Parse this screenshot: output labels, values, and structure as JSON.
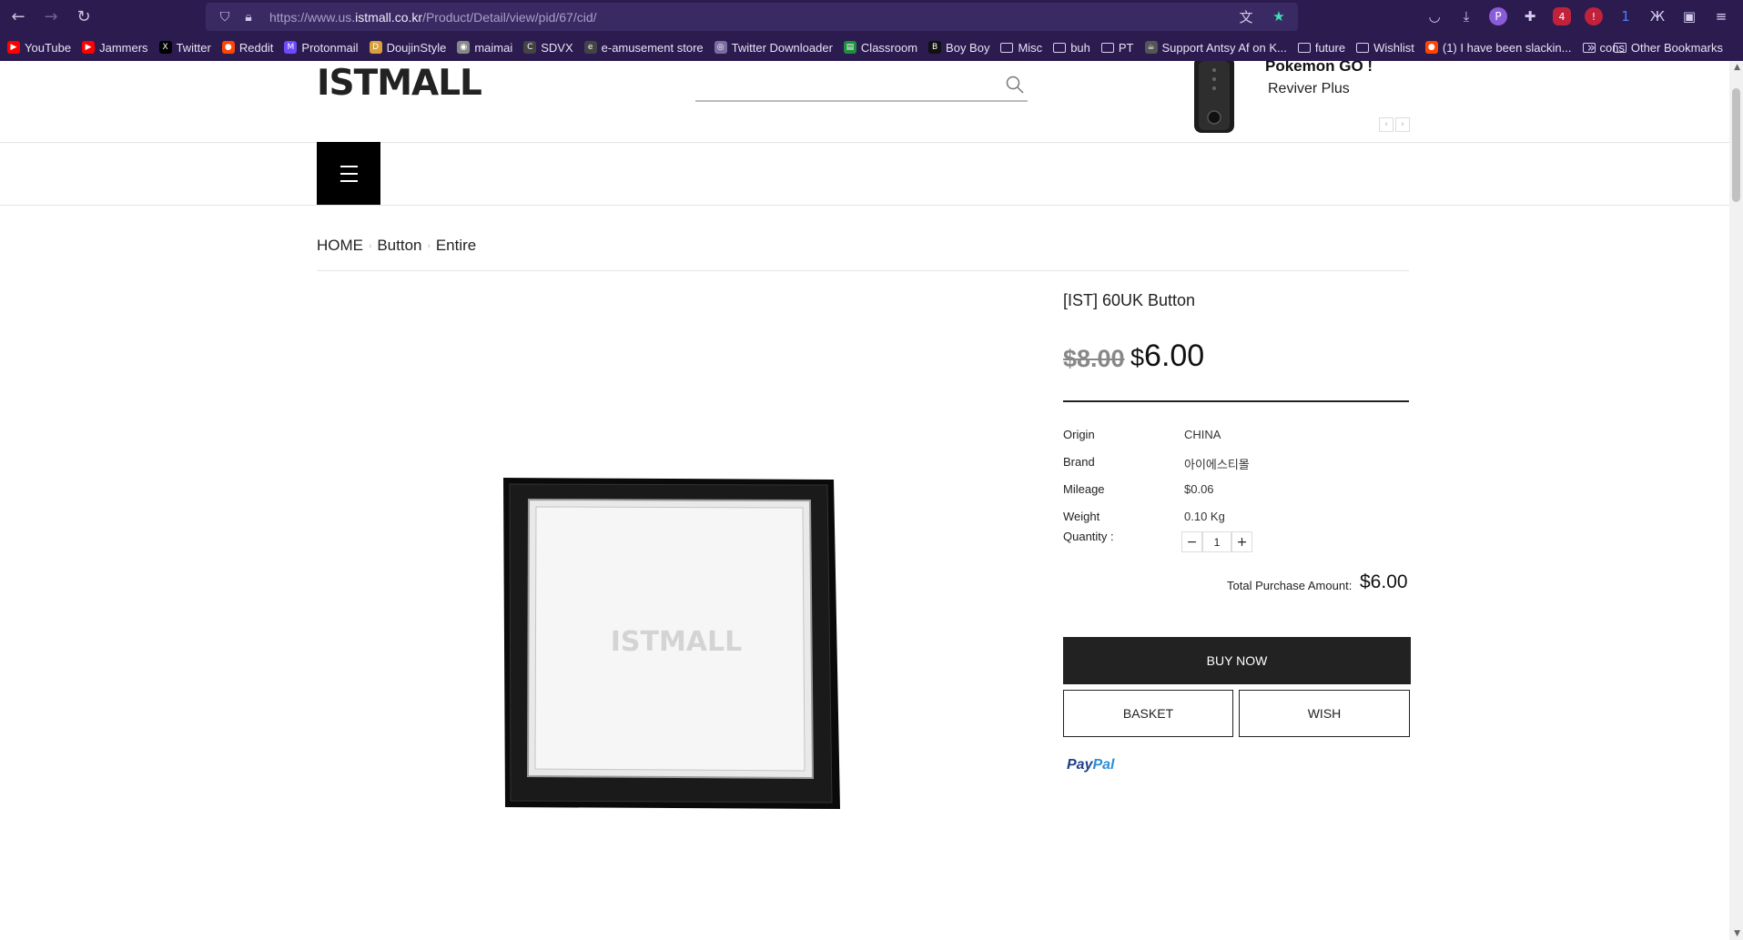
{
  "browser": {
    "url_prefix": "https://www.us.",
    "url_host": "istmall.co.kr",
    "url_path": "/Product/Detail/view/pid/67/cid/",
    "bookmarks": [
      {
        "label": "YouTube",
        "icon": "youtube-icon",
        "color": "#ff0000"
      },
      {
        "label": "Jammers",
        "icon": "youtube-icon",
        "color": "#ff0000"
      },
      {
        "label": "Twitter",
        "icon": "x-icon",
        "color": "#000000"
      },
      {
        "label": "Reddit",
        "icon": "reddit-icon",
        "color": "#ff4500"
      },
      {
        "label": "Protonmail",
        "icon": "protonmail-icon",
        "color": "#6d4aff"
      },
      {
        "label": "DoujinStyle",
        "icon": "doujinstyle-icon",
        "color": "#d9a13b"
      },
      {
        "label": "maimai",
        "icon": "maimai-icon",
        "color": "#888888"
      },
      {
        "label": "SDVX",
        "icon": "sdvx-icon",
        "color": "#444444"
      },
      {
        "label": "e-amusement store",
        "icon": "eamusement-icon",
        "color": "#444444"
      },
      {
        "label": "Twitter Downloader",
        "icon": "globe-icon",
        "color": "#7a6ea0"
      },
      {
        "label": "Classroom",
        "icon": "classroom-icon",
        "color": "#1e8e3e"
      },
      {
        "label": "Boy Boy",
        "icon": "boyboy-icon",
        "color": "#111111"
      },
      {
        "label": "Misc",
        "icon": "folder-icon",
        "color": ""
      },
      {
        "label": "buh",
        "icon": "folder-icon",
        "color": ""
      },
      {
        "label": "PT",
        "icon": "folder-icon",
        "color": ""
      },
      {
        "label": "Support Antsy Af on K...",
        "icon": "kofi-icon",
        "color": "#555555"
      },
      {
        "label": "future",
        "icon": "folder-icon",
        "color": ""
      },
      {
        "label": "Wishlist",
        "icon": "folder-icon",
        "color": ""
      },
      {
        "label": "(1) I have been slackin...",
        "icon": "reddit-icon",
        "color": "#ff4500"
      },
      {
        "label": "cons",
        "icon": "folder-icon",
        "color": ""
      }
    ],
    "other_bookmarks": "Other Bookmarks",
    "badges": {
      "ublock": "4",
      "bitwarden": "1"
    }
  },
  "site": {
    "logo": "ISTMALL",
    "promo_title": "Pokemon GO !",
    "promo_subtitle": "Reviver Plus"
  },
  "breadcrumb": [
    "HOME",
    "Button",
    "Entire"
  ],
  "product": {
    "title": "[IST] 60UK Button",
    "price_old": "$8.00",
    "price_currency": "$",
    "price_new": "6.00",
    "specs": [
      {
        "label": "Origin",
        "value": "CHINA"
      },
      {
        "label": "Brand",
        "value": "아이에스티몰"
      },
      {
        "label": "Mileage",
        "value": "$0.06"
      },
      {
        "label": "Weight",
        "value": "0.10 Kg"
      }
    ],
    "quantity_label": "Quantity :",
    "quantity": "1",
    "total_label": "Total Purchase Amount:",
    "total_value": "$6.00",
    "image_watermark": "ISTMALL"
  },
  "actions": {
    "buy_now": "BUY NOW",
    "basket": "BASKET",
    "wish": "WISH",
    "paypal_pay": "Pay",
    "paypal_pal": "Pal"
  }
}
